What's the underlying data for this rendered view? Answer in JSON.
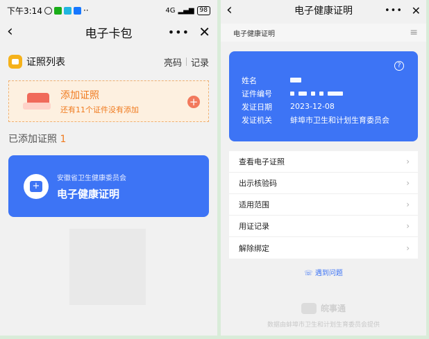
{
  "left": {
    "status": {
      "time": "下午3:14",
      "network": "4G",
      "battery": "98"
    },
    "nav": {
      "back": "‹",
      "title": "电子卡包",
      "more": "•••",
      "close": "✕"
    },
    "section": {
      "title": "证照列表",
      "link1": "亮码",
      "link2": "记录"
    },
    "add_card": {
      "title": "添加证照",
      "subtitle": "还有11个证件没有添加",
      "plus": "+"
    },
    "added": {
      "label": "已添加证照",
      "count": "1"
    },
    "cert": {
      "org": "安徽省卫生健康委员会",
      "name": "电子健康证明"
    }
  },
  "right": {
    "nav": {
      "back": "‹",
      "title": "电子健康证明",
      "more": "•••",
      "close": "✕"
    },
    "sub_header": {
      "title": "电子健康证明",
      "menu": "≡"
    },
    "card": {
      "help": "?",
      "rows": [
        {
          "label": "姓名",
          "value": ""
        },
        {
          "label": "证件编号",
          "value": ""
        },
        {
          "label": "发证日期",
          "value": "2023-12-08"
        },
        {
          "label": "发证机关",
          "value": "蚌埠市卫生和计划生育委员会"
        }
      ]
    },
    "menu": [
      {
        "label": "查看电子证照"
      },
      {
        "label": "出示核验码"
      },
      {
        "label": "适用范围"
      },
      {
        "label": "用证记录"
      },
      {
        "label": "解除绑定"
      }
    ],
    "chevron": "›",
    "problem": "遇到问题",
    "footer_logo": "皖事通",
    "footer_text": "数据由蚌埠市卫生和计划生育委员会提供"
  },
  "colors": {
    "accent_blue": "#3d74f5",
    "orange": "#f07a1e",
    "background": "#f1f1f1",
    "border_green": "#d9ecd9"
  }
}
